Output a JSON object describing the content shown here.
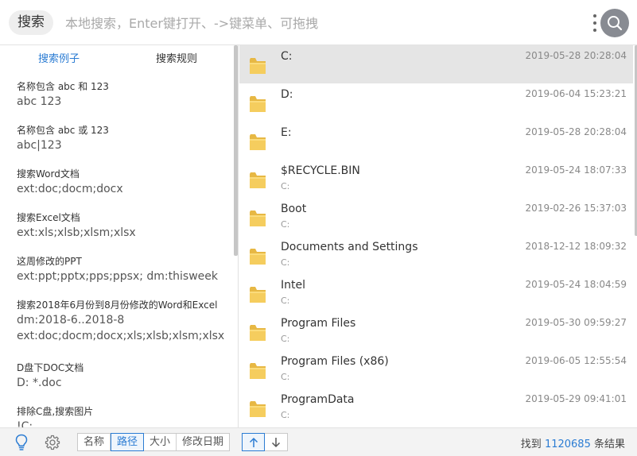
{
  "header": {
    "search_tag": "搜索",
    "search_placeholder": "本地搜索，Enter键打开、->键菜单、可拖拽",
    "more_icon": "more-vertical-icon",
    "search_icon": "search-icon",
    "search_button_color": "#888b92"
  },
  "sidebar": {
    "tabs": [
      {
        "label": "搜索例子",
        "active": true
      },
      {
        "label": "搜索规则",
        "active": false
      }
    ],
    "examples": [
      {
        "title": "名称包含 abc 和 123",
        "query": "abc 123"
      },
      {
        "title": "名称包含 abc 或 123",
        "query": "abc|123"
      },
      {
        "title": "搜索Word文档",
        "query": "ext:doc;docm;docx"
      },
      {
        "title": "搜索Excel文档",
        "query": "ext:xls;xlsb;xlsm;xlsx"
      },
      {
        "title": "这周修改的PPT",
        "query": "ext:ppt;pptx;pps;ppsx; dm:thisweek"
      },
      {
        "title": "搜索2018年6月份到8月份修改的Word和Excel",
        "query": "dm:2018-6..2018-8",
        "query2": "ext:doc;docm;docx;xls;xlsb;xlsm;xlsx"
      },
      {
        "title": "D盘下DOC文档",
        "query": "D: *.doc"
      },
      {
        "title": "排除C盘,搜索图片",
        "query": "!C:"
      }
    ]
  },
  "results": {
    "files": [
      {
        "name": "C:",
        "path": "",
        "date": "2019-05-28 20:28:04",
        "selected": true
      },
      {
        "name": "D:",
        "path": "",
        "date": "2019-06-04 15:23:21",
        "selected": false
      },
      {
        "name": "E:",
        "path": "",
        "date": "2019-05-28 20:28:04",
        "selected": false
      },
      {
        "name": "$RECYCLE.BIN",
        "path": "C:",
        "date": "2019-05-24 18:07:33",
        "selected": false
      },
      {
        "name": "Boot",
        "path": "C:",
        "date": "2019-02-26 15:37:03",
        "selected": false
      },
      {
        "name": "Documents and Settings",
        "path": "C:",
        "date": "2018-12-12 18:09:32",
        "selected": false
      },
      {
        "name": "Intel",
        "path": "C:",
        "date": "2019-05-24 18:04:59",
        "selected": false
      },
      {
        "name": "Program Files",
        "path": "C:",
        "date": "2019-05-30 09:59:27",
        "selected": false
      },
      {
        "name": "Program Files (x86)",
        "path": "C:",
        "date": "2019-06-05 12:55:54",
        "selected": false
      },
      {
        "name": "ProgramData",
        "path": "C:",
        "date": "2019-05-29 09:41:01",
        "selected": false
      }
    ],
    "folder_icon": "folder-icon",
    "folder_color": "#f5cd5e"
  },
  "footer": {
    "bulb_icon": "lightbulb-icon",
    "gear_icon": "gear-icon",
    "sort_options": [
      {
        "label": "名称",
        "active": false
      },
      {
        "label": "路径",
        "active": true
      },
      {
        "label": "大小",
        "active": false
      },
      {
        "label": "修改日期",
        "active": false
      }
    ],
    "sort_up_icon": "arrow-up-icon",
    "sort_down_icon": "arrow-down-icon",
    "sort_direction": "up",
    "result_prefix": "找到",
    "result_count": "1120685",
    "result_suffix": "条结果",
    "accent_color": "#2b7cd3"
  }
}
